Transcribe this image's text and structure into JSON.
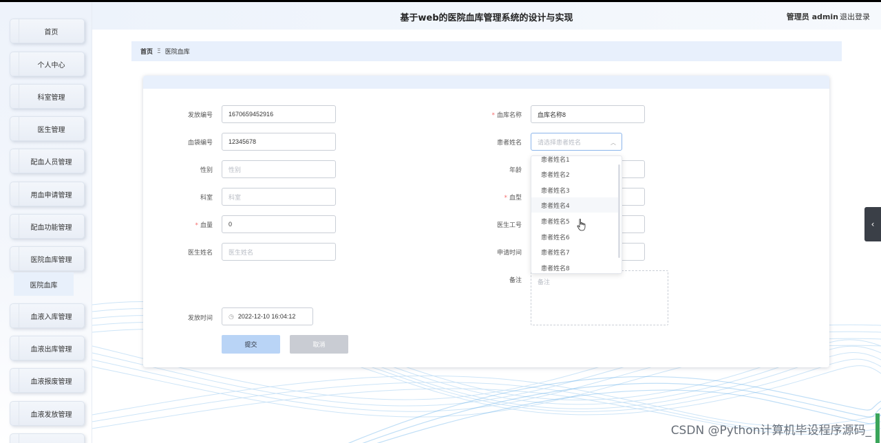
{
  "header": {
    "title": "基于web的医院血库管理系统的设计与实现",
    "user": "管理员 admin",
    "logout": "退出登录"
  },
  "sidebar": {
    "items": [
      {
        "label": "首页"
      },
      {
        "label": "个人中心"
      },
      {
        "label": "科室管理"
      },
      {
        "label": "医生管理"
      },
      {
        "label": "配血人员管理"
      },
      {
        "label": "用血申请管理"
      },
      {
        "label": "配血功能管理"
      },
      {
        "label": "医院血库管理"
      },
      {
        "label": "血液入库管理"
      },
      {
        "label": "血液出库管理"
      },
      {
        "label": "血液报废管理"
      },
      {
        "label": "血液发放管理"
      }
    ],
    "active_sub": "医院血库"
  },
  "breadcrumb": {
    "home": "首页",
    "separator": "Ξ",
    "current": "医院血库"
  },
  "form": {
    "issue_no": {
      "label": "发放编号",
      "value": "1670659452916"
    },
    "bag_no": {
      "label": "血袋编号",
      "value": "12345678"
    },
    "gender": {
      "label": "性别",
      "placeholder": "性别"
    },
    "dept": {
      "label": "科室",
      "placeholder": "科室"
    },
    "volume": {
      "label": "血量",
      "value": "0"
    },
    "doctor_name": {
      "label": "医生姓名",
      "placeholder": "医生姓名"
    },
    "issue_time": {
      "label": "发放时间",
      "value": "2022-12-10 16:04:12"
    },
    "bank_name": {
      "label": "血库名称",
      "value": "血库名称8"
    },
    "patient_name": {
      "label": "患者姓名",
      "placeholder": "请选择患者姓名"
    },
    "age": {
      "label": "年龄"
    },
    "blood_type": {
      "label": "血型"
    },
    "doctor_id": {
      "label": "医生工号"
    },
    "apply_time": {
      "label": "申请时间"
    },
    "remark": {
      "label": "备注",
      "placeholder": "备注"
    },
    "submit": "提交",
    "cancel": "取消"
  },
  "dropdown": {
    "options": [
      "患者姓名1",
      "患者姓名2",
      "患者姓名3",
      "患者姓名4",
      "患者姓名5",
      "患者姓名6",
      "患者姓名7",
      "患者姓名8"
    ],
    "hover_index": 3
  },
  "watermark": "CSDN @Python计算机毕设程序源码_",
  "colors": {
    "accent": "#b9d4f6",
    "breadcrumb_bg": "#e8f0fc",
    "required": "#f56c6c"
  }
}
